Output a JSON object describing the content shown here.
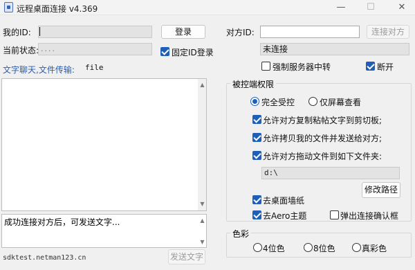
{
  "window": {
    "title": "远程桌面连接 v4.369",
    "min": "—",
    "max": "☐",
    "close": "✕"
  },
  "left": {
    "my_id_label": "我的ID:",
    "my_id_value": "",
    "login_button": "登录",
    "status_label": "当前状态:",
    "status_value": "....",
    "fixed_id_label": "固定ID登录",
    "fixed_id_checked": true,
    "chat_link": "文字聊天,文件传输:",
    "file_label": "file",
    "chat_log": "",
    "message_input": "成功连接对方后，可发送文字...",
    "footer_url": "sdktest.netman123.cn",
    "send_button": "发送文字"
  },
  "right": {
    "peer_id_label": "对方ID:",
    "peer_id_value": "",
    "connect_button": "连接对方",
    "connection_status": "未连接",
    "force_relay_label": "强制服务器中转",
    "force_relay_checked": false,
    "disconnect_label": "断开",
    "disconnect_checked": true,
    "permissions": {
      "title": "被控端权限",
      "full_control": "完全受控",
      "view_only": "仅屏幕查看",
      "allow_clipboard": "允许对方复制粘帖文字到剪切板;",
      "allow_send_files": "允许拷贝我的文件并发送给对方;",
      "allow_drag_files": "允许对方拖动文件到如下文件夹:",
      "folder_path": "d:\\",
      "change_path_button": "修改路径",
      "remove_wallpaper": "去桌面墙纸",
      "remove_aero": "去Aero主题",
      "popup_confirm": "弹出连接确认框"
    },
    "color": {
      "title": "色彩",
      "options": [
        "4位色",
        "8位色",
        "真彩色"
      ],
      "selected": null
    }
  }
}
